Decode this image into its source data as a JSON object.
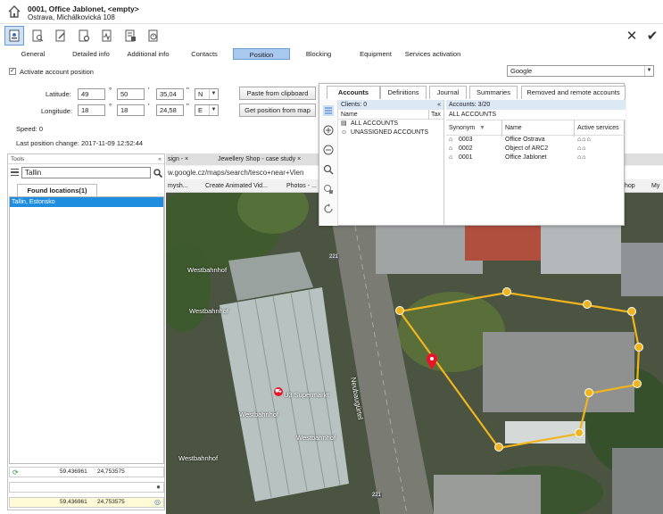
{
  "window": {
    "title": "0001, Office Jablonet, <empty>",
    "subtitle": "Ostrava, Michálkovická 108"
  },
  "toolbar": {
    "icons": [
      "account-card-icon",
      "search-doc-icon",
      "edit-doc-icon",
      "settings-doc-icon",
      "signal-doc-icon",
      "list-doc-icon",
      "history-doc-icon"
    ],
    "close_glyph": "✕",
    "confirm_glyph": "✔"
  },
  "tabs": [
    "General",
    "Detailed info",
    "Additional info",
    "Contacts",
    "Position",
    "Blocking",
    "Equipment",
    "Services activation"
  ],
  "active_tab": "Position",
  "position": {
    "activate_label": "Activate account position",
    "activate_checked": true,
    "provider": "Google",
    "latitude_label": "Latitude:",
    "longitude_label": "Longitude:",
    "lat": {
      "deg": "49",
      "min": "50",
      "sec": "35,04",
      "hemi": "N"
    },
    "lon": {
      "deg": "18",
      "min": "18",
      "sec": "24,58",
      "hemi": "E"
    },
    "deg_sym": "°",
    "min_sym": "'",
    "sec_sym": "\"",
    "paste_button": "Paste from clipboard",
    "getmap_button": "Get position from map",
    "speed": "Speed: 0",
    "last_change": "Last position change: 2017-11-09 12:52:44"
  },
  "tools": {
    "header": "Tools",
    "collapse": "«",
    "search_value": "Tallin",
    "found_tab": "Found locations(1)",
    "found_items": [
      "Tallin, Estonsko"
    ],
    "coords_1": {
      "lat": "59,436961",
      "lon": "24,753575"
    },
    "coords_2": {
      "lat": "59,436961",
      "lon": "24,753575"
    }
  },
  "browser": {
    "tab1": "sign - ×",
    "tab2": "Jewellery Shop - case study ×",
    "url": "w.google.cz/maps/search/tesco+near+Vien",
    "bookmarks": [
      "mysh...",
      "Create Animated Vid...",
      "Photos - ...",
      "hop",
      "My"
    ]
  },
  "map": {
    "labels": [
      "Westbahnhof",
      "Westbahnhof",
      "Westbahnhof",
      "Westbahnhof",
      "Westbahnhof",
      "U3 Supermarkt",
      "Neubaugürtel",
      "221",
      "221"
    ],
    "colors": {
      "polygon": "#f0b41e",
      "pin": "#e8152b",
      "roof": "#cfd6d4"
    }
  },
  "popup": {
    "tabs": [
      "Accounts",
      "Definitions",
      "Journal",
      "Summaries",
      "Removed and remote accounts"
    ],
    "active_tab": "Accounts",
    "clients_header": "Clients: 0",
    "clients_cols": [
      "Name",
      "Tax"
    ],
    "clients_rows": [
      "ALL ACCOUNTS",
      "UNASSIGNED ACCOUNTS"
    ],
    "accounts_header": "Accounts: 3/20",
    "accounts_group": "ALL ACCOUNTS",
    "accounts_cols": [
      "Synonym",
      "Name",
      "Active services"
    ],
    "accounts_rows": [
      {
        "synonym": "0003",
        "name": "Office Ostrava"
      },
      {
        "synonym": "0002",
        "name": "Object of ARC2"
      },
      {
        "synonym": "0001",
        "name": "Office Jablonet"
      }
    ]
  }
}
